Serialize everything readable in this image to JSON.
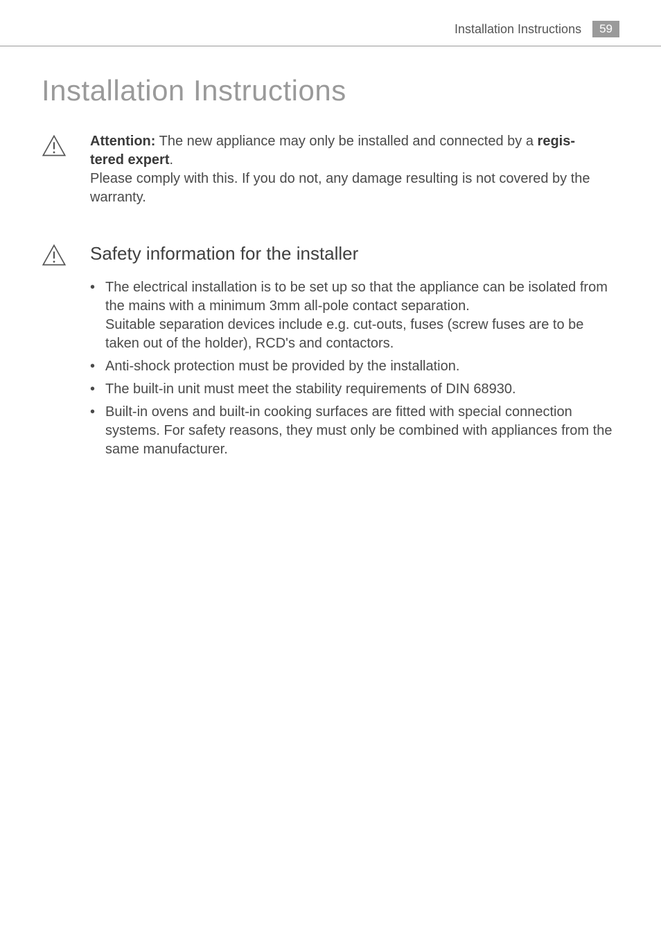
{
  "header": {
    "title": "Installation Instructions",
    "page_number": "59"
  },
  "main_heading": "Installation Instructions",
  "attention_block": {
    "prefix_bold": "Attention:",
    "line1_mid": " The new appliance may only be installed and connected by a ",
    "line1_bold_end": "regis-",
    "line2_bold": "tered expert",
    "line2_after": ".",
    "line3": "Please comply with this. If you do not, any damage resulting is not covered by the warranty."
  },
  "safety_section": {
    "heading": "Safety information for the installer",
    "bullets": [
      {
        "text": "The electrical installation is to be set up so that the appliance can be isolated from the mains with a minimum 3mm all-pole contact separation.",
        "sub": "Suitable separation devices include e.g. cut-outs, fuses (screw fuses are to be taken out of the holder), RCD's and contactors."
      },
      {
        "text": "Anti-shock protection must be provided by the installation."
      },
      {
        "text": "The built-in unit must meet the stability requirements of DIN 68930."
      },
      {
        "text": "Built-in ovens and built-in cooking surfaces are fitted with special connection systems. For safety reasons, they must only be combined with appliances from the same manufacturer."
      }
    ]
  }
}
